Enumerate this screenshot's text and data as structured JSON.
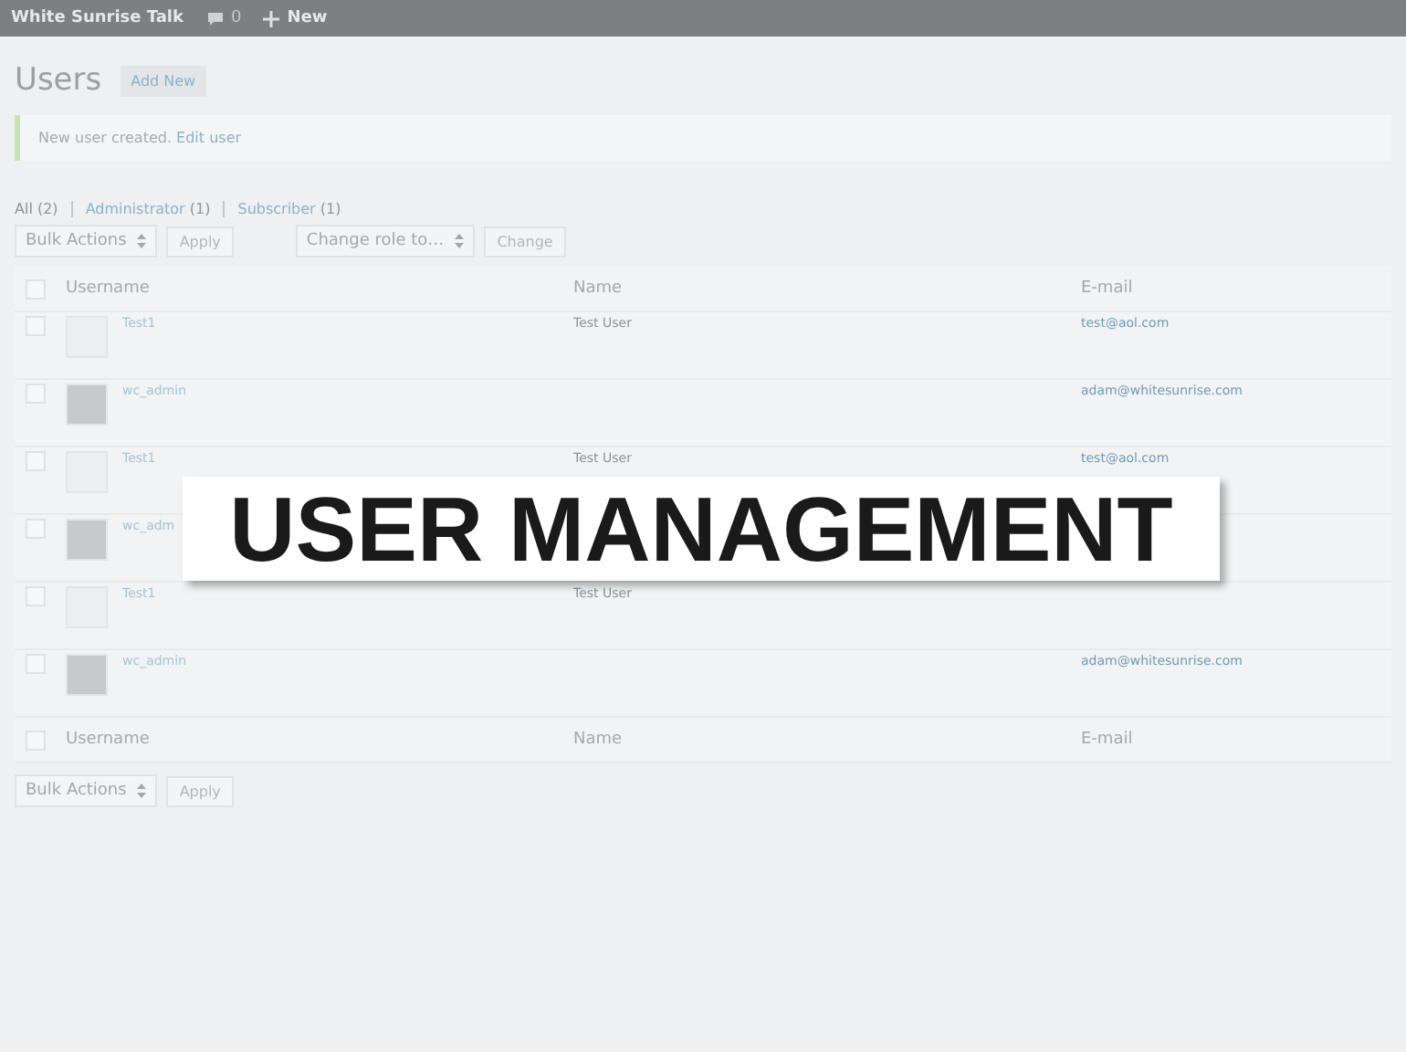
{
  "admin_bar": {
    "site_title": "White Sunrise Talk",
    "comments_count": "0",
    "new_label": "New"
  },
  "page": {
    "title": "Users",
    "add_new": "Add New"
  },
  "notice": {
    "text": "New user created.",
    "link": "Edit user"
  },
  "filters": [
    {
      "label": "All",
      "count": "(2)",
      "selected": true
    },
    {
      "label": "Administrator",
      "count": "(1)",
      "selected": false
    },
    {
      "label": "Subscriber",
      "count": "(1)",
      "selected": false
    }
  ],
  "top_actions": {
    "bulk": "Bulk Actions",
    "apply": "Apply",
    "role": "Change role to…",
    "change": "Change"
  },
  "table": {
    "columns": [
      "Username",
      "Name",
      "E-mail"
    ],
    "header_checked": false,
    "rows": [
      {
        "kind": "blank",
        "username": "Test1",
        "name": "Test User",
        "email": "test@aol.com",
        "checked": false
      },
      {
        "kind": "photo",
        "username": "wc_admin",
        "email": "adam@whitesunrise.com",
        "checked": false
      },
      {
        "kind": "blank",
        "username": "Test1",
        "name": "Test User",
        "email": "test@aol.com",
        "checked": false
      },
      {
        "kind": "photo",
        "username": "wc_adm",
        "checked": false
      },
      {
        "kind": "blank",
        "username": "Test1",
        "name": "Test User",
        "checked": false
      },
      {
        "kind": "photo",
        "username": "wc_admin",
        "email": "adam@whitesunrise.com",
        "checked": false
      }
    ],
    "footer_columns": [
      "Username",
      "Name",
      "E-mail"
    ],
    "footer_checked": false
  },
  "bottom_actions": {
    "bulk": "Bulk Actions",
    "apply": "Apply"
  },
  "overlay": {
    "title": "USER MANAGEMENT"
  }
}
